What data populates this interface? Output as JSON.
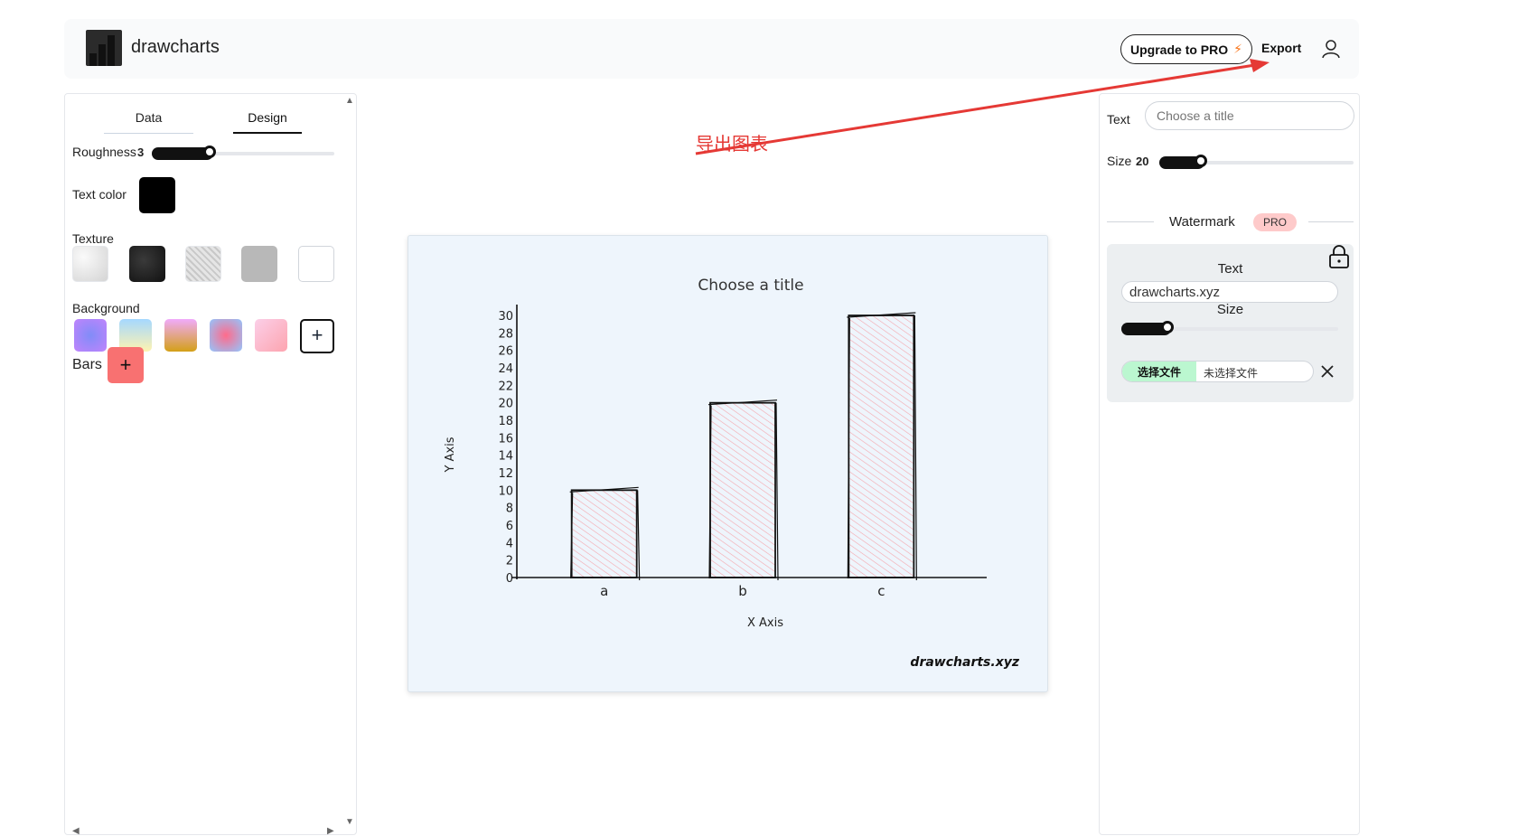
{
  "header": {
    "app_name": "drawcharts",
    "upgrade_label": "Upgrade to PRO",
    "export_label": "Export"
  },
  "left_panel": {
    "tabs": [
      {
        "label": "Data"
      },
      {
        "label": "Design"
      }
    ],
    "active_tab": "Design",
    "roughness": {
      "label": "Roughness",
      "value": "3",
      "level": 0.3
    },
    "text_color": {
      "label": "Text color",
      "value": "#000000"
    },
    "texture": {
      "label": "Texture"
    },
    "background": {
      "label": "Background"
    },
    "bars": {
      "label": "Bars",
      "color": "#f87171"
    }
  },
  "annotation": {
    "text": "导出图表",
    "color": "#e53935"
  },
  "chart_data": {
    "type": "bar",
    "title": "Choose a title",
    "xlabel": "X Axis",
    "ylabel": "Y Axis",
    "categories": [
      "a",
      "b",
      "c"
    ],
    "values": [
      10,
      20,
      30
    ],
    "ylim": [
      0,
      30
    ],
    "yticks": [
      "0",
      "2",
      "4",
      "6",
      "8",
      "10",
      "12",
      "14",
      "16",
      "18",
      "20",
      "22",
      "24",
      "26",
      "28",
      "30"
    ],
    "bar_color": "#f4a6ad",
    "background": "#eef5fc",
    "watermark": "drawcharts.xyz"
  },
  "right_panel": {
    "text_label": "Text",
    "title_placeholder": "Choose a title",
    "size_label": "Size",
    "size_value": "20",
    "size_level": 0.2,
    "watermark_heading": "Watermark",
    "pro_badge": "PRO",
    "watermark": {
      "text_label": "Text",
      "text_value": "drawcharts.xyz",
      "size_label": "Size",
      "size_level": 0.2,
      "file_button": "选择文件",
      "file_status": "未选择文件"
    }
  }
}
